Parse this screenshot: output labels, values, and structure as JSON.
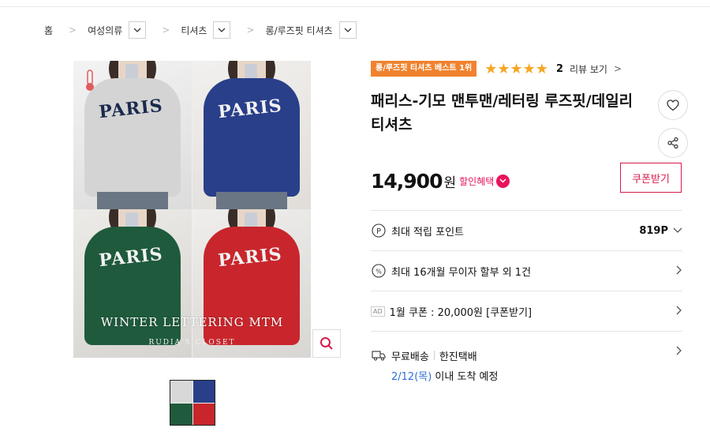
{
  "breadcrumb": {
    "home": "홈",
    "crumbs": [
      "여성의류",
      "티셔츠",
      "롱/루즈핏 티셔츠"
    ]
  },
  "gallery": {
    "image_text": "WINTER LETTERING MTM",
    "image_subtext": "RUDIA'S CLOSET",
    "shirt_lettering": "PARIS"
  },
  "product": {
    "badge": "롱/루즈핏 티셔츠 베스트 1위",
    "stars": "★★★★★",
    "review_count": "2",
    "review_link": "리뷰 보기",
    "title": "패리스-기모 맨투맨/레터링 루즈핏/데일리 티셔츠",
    "price": "14,900",
    "price_unit": "원",
    "benefit_label": "할인혜택",
    "coupon_button": "쿠폰받기"
  },
  "details": {
    "points_label": "최대 적립 포인트",
    "points_value": "819P",
    "installment_label": "최대 16개월 무이자 할부 외 1건",
    "ad_tag": "AD",
    "ad_coupon": "1월 쿠폰 : 20,000원 [쿠폰받기]",
    "shipping_free": "무료배송",
    "shipping_carrier": "한진택배",
    "delivery_date": "2/12(목)",
    "delivery_text": " 이내 도착 예정"
  },
  "colors": {
    "accent_pink": "#e8145b",
    "badge_orange": "#f0822d",
    "star_yellow": "#f5a623",
    "date_blue": "#2e6fd6"
  }
}
